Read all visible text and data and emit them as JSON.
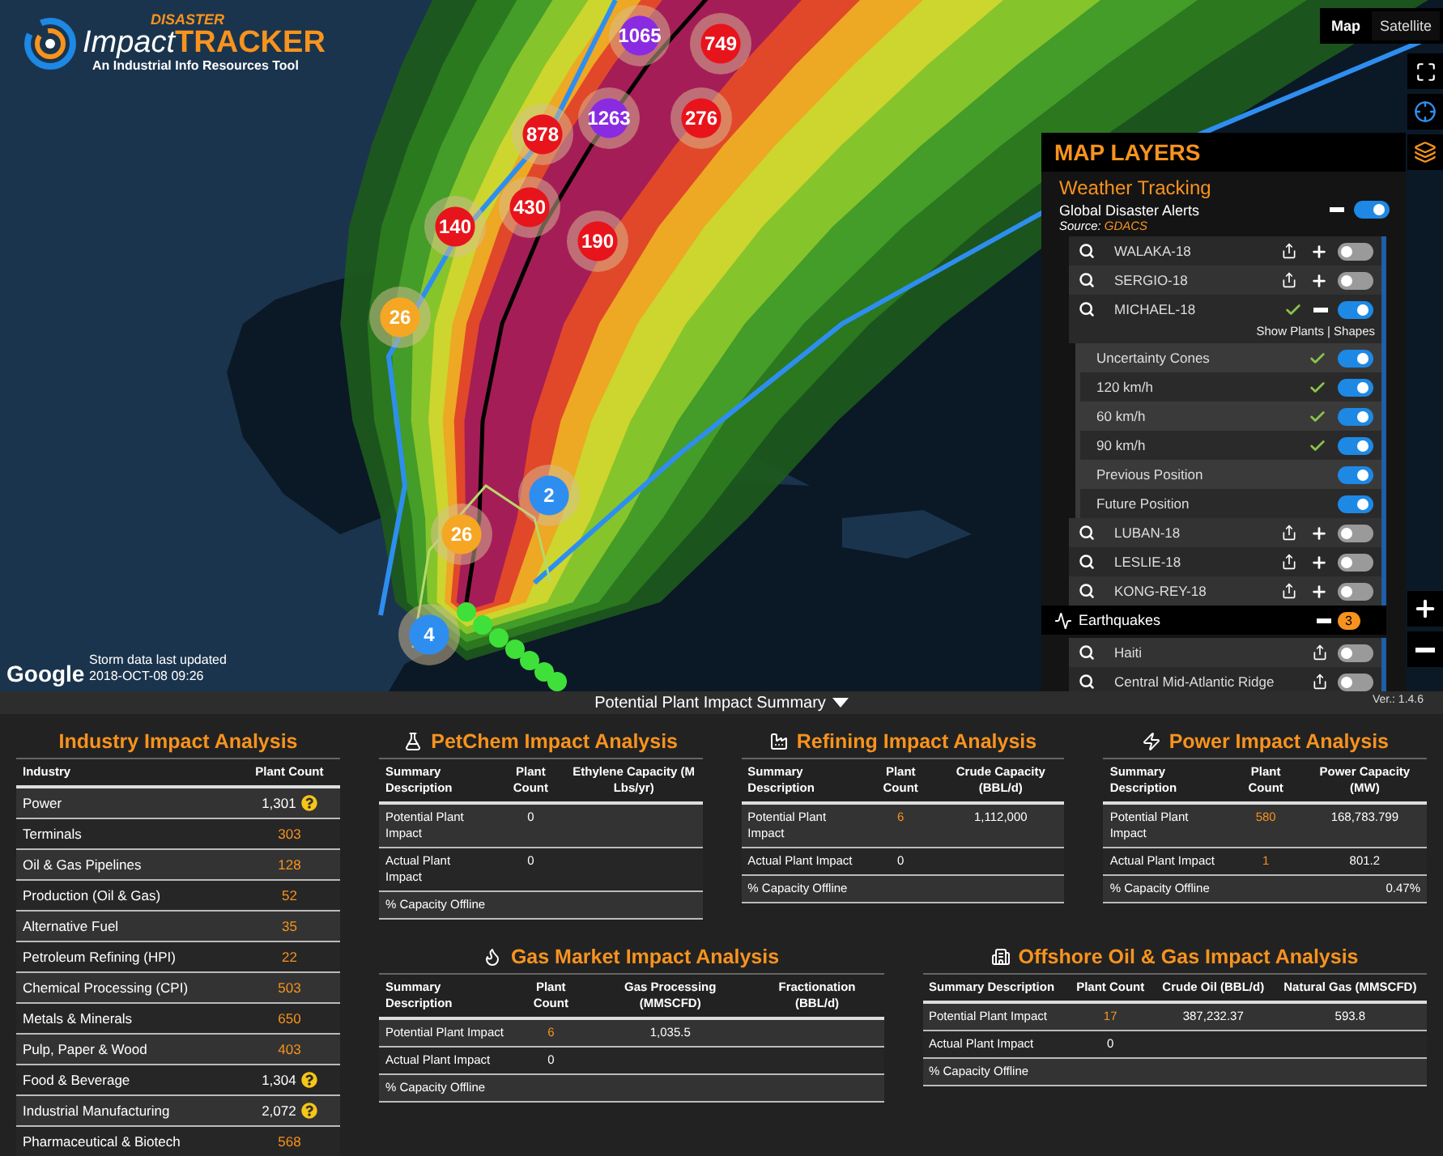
{
  "logo": {
    "kicker": "DISASTER",
    "name_a": "Impact",
    "name_b": "TRACKER",
    "tagline": "An Industrial Info Resources Tool"
  },
  "map": {
    "view_buttons": [
      {
        "label": "Map",
        "selected": true
      },
      {
        "label": "Satellite",
        "selected": false
      }
    ],
    "clusters": [
      {
        "count": "1065",
        "color": "#8a2be2"
      },
      {
        "count": "749",
        "color": "#e8141c"
      },
      {
        "count": "1263",
        "color": "#8a2be2"
      },
      {
        "count": "878",
        "color": "#e8141c"
      },
      {
        "count": "276",
        "color": "#e8141c"
      },
      {
        "count": "140",
        "color": "#e8141c"
      },
      {
        "count": "430",
        "color": "#e8141c"
      },
      {
        "count": "190",
        "color": "#e8141c"
      },
      {
        "count": "26",
        "color": "#f5a623"
      },
      {
        "count": "2",
        "color": "#2e8ef0"
      },
      {
        "count": "26",
        "color": "#f5a623"
      },
      {
        "count": "4",
        "color": "#2e8ef0"
      }
    ],
    "attribution": "Google",
    "storm_note": "Storm data last updated",
    "storm_time": "2018-OCT-08 09:26"
  },
  "map_layers": {
    "title": "MAP LAYERS",
    "section": "Weather Tracking",
    "alerts": {
      "label": "Global Disaster Alerts",
      "expanded": true,
      "on": true,
      "source_label": "Source:",
      "source": "GDACS"
    },
    "storms": [
      {
        "name": "WALAKA-18",
        "checked": false,
        "expanded": false,
        "on": false
      },
      {
        "name": "SERGIO-18",
        "checked": false,
        "expanded": false,
        "on": false
      },
      {
        "name": "MICHAEL-18",
        "checked": true,
        "expanded": true,
        "on": true,
        "links": "Show Plants | Shapes",
        "layers": [
          {
            "name": "Uncertainty Cones",
            "checked": true,
            "on": true
          },
          {
            "name": "120 km/h",
            "checked": true,
            "on": true
          },
          {
            "name": "60 km/h",
            "checked": true,
            "on": true
          },
          {
            "name": "90 km/h",
            "checked": true,
            "on": true
          },
          {
            "name": "Previous Position",
            "checked": false,
            "on": true
          },
          {
            "name": "Future Position",
            "checked": false,
            "on": true
          }
        ]
      },
      {
        "name": "LUBAN-18",
        "checked": false,
        "expanded": false,
        "on": false
      },
      {
        "name": "LESLIE-18",
        "checked": false,
        "expanded": false,
        "on": false
      },
      {
        "name": "KONG-REY-18",
        "checked": false,
        "expanded": false,
        "on": false
      }
    ],
    "earthquakes": {
      "label": "Earthquakes",
      "expanded": true,
      "count": "3",
      "items": [
        {
          "name": "Haiti",
          "on": false
        },
        {
          "name": "Central Mid-Atlantic Ridge",
          "on": false
        }
      ]
    }
  },
  "summary_bar": {
    "title": "Potential Plant Impact Summary",
    "expanded": true,
    "version": "Ver.: 1.4.6"
  },
  "industry": {
    "title": "Industry Impact Analysis",
    "columns": [
      "Industry",
      "Plant Count"
    ],
    "rows": [
      {
        "industry": "Power",
        "count": "1,301",
        "flagged": true
      },
      {
        "industry": "Terminals",
        "count": "303",
        "flagged": false
      },
      {
        "industry": "Oil & Gas Pipelines",
        "count": "128",
        "flagged": false
      },
      {
        "industry": "Production (Oil & Gas)",
        "count": "52",
        "flagged": false
      },
      {
        "industry": "Alternative Fuel",
        "count": "35",
        "flagged": false
      },
      {
        "industry": "Petroleum Refining (HPI)",
        "count": "22",
        "flagged": false
      },
      {
        "industry": "Chemical Processing (CPI)",
        "count": "503",
        "flagged": false
      },
      {
        "industry": "Metals & Minerals",
        "count": "650",
        "flagged": false
      },
      {
        "industry": "Pulp, Paper & Wood",
        "count": "403",
        "flagged": false
      },
      {
        "industry": "Food & Beverage",
        "count": "1,304",
        "flagged": true
      },
      {
        "industry": "Industrial Manufacturing",
        "count": "2,072",
        "flagged": true
      },
      {
        "industry": "Pharmaceutical & Biotech",
        "count": "568",
        "flagged": false
      }
    ]
  },
  "panels": [
    {
      "title": "PetChem Impact Analysis",
      "columns": [
        "Summary Description",
        "Plant Count",
        "Ethylene Capacity (M Lbs/yr)"
      ],
      "rows": [
        {
          "label": "Potential Plant Impact",
          "count": "0",
          "linked": false,
          "values": []
        },
        {
          "label": "Actual Plant Impact",
          "count": "0",
          "linked": false,
          "values": []
        },
        {
          "label": "% Capacity Offline",
          "values": []
        }
      ]
    },
    {
      "title": "Refining Impact Analysis",
      "columns": [
        "Summary Description",
        "Plant Count",
        "Crude Capacity (BBL/d)"
      ],
      "rows": [
        {
          "label": "Potential Plant Impact",
          "count": "6",
          "linked": true,
          "values": [
            "1,112,000"
          ]
        },
        {
          "label": "Actual Plant Impact",
          "count": "0",
          "linked": false,
          "values": []
        },
        {
          "label": "% Capacity Offline",
          "values": []
        }
      ]
    },
    {
      "title": "Power Impact Analysis",
      "columns": [
        "Summary Description",
        "Plant Count",
        "Power Capacity (MW)"
      ],
      "rows": [
        {
          "label": "Potential Plant Impact",
          "count": "580",
          "linked": true,
          "values": [
            "168,783.799"
          ]
        },
        {
          "label": "Actual Plant Impact",
          "count": "1",
          "linked": true,
          "values": [
            "801.2"
          ]
        },
        {
          "label": "% Capacity Offline",
          "values": [
            "0.47%"
          ]
        }
      ]
    },
    {
      "title": "Gas Market Impact Analysis",
      "columns": [
        "Summary Description",
        "Plant Count",
        "Gas Processing (MMSCFD)",
        "Fractionation (BBL/d)"
      ],
      "rows": [
        {
          "label": "Potential Plant Impact",
          "count": "6",
          "linked": true,
          "values": [
            "1,035.5"
          ]
        },
        {
          "label": "Actual Plant Impact",
          "count": "0",
          "linked": false,
          "values": []
        },
        {
          "label": "% Capacity Offline",
          "values": []
        }
      ]
    },
    {
      "title": "Offshore Oil & Gas Impact Analysis",
      "columns": [
        "Summary Description",
        "Plant Count",
        "Crude Oil (BBL/d)",
        "Natural Gas (MMSCFD)"
      ],
      "rows": [
        {
          "label": "Potential Plant Impact",
          "count": "17",
          "linked": true,
          "values": [
            "387,232.37",
            "593.8"
          ]
        },
        {
          "label": "Actual Plant Impact",
          "count": "0",
          "linked": false,
          "values": []
        },
        {
          "label": "% Capacity Offline",
          "values": []
        }
      ]
    }
  ]
}
